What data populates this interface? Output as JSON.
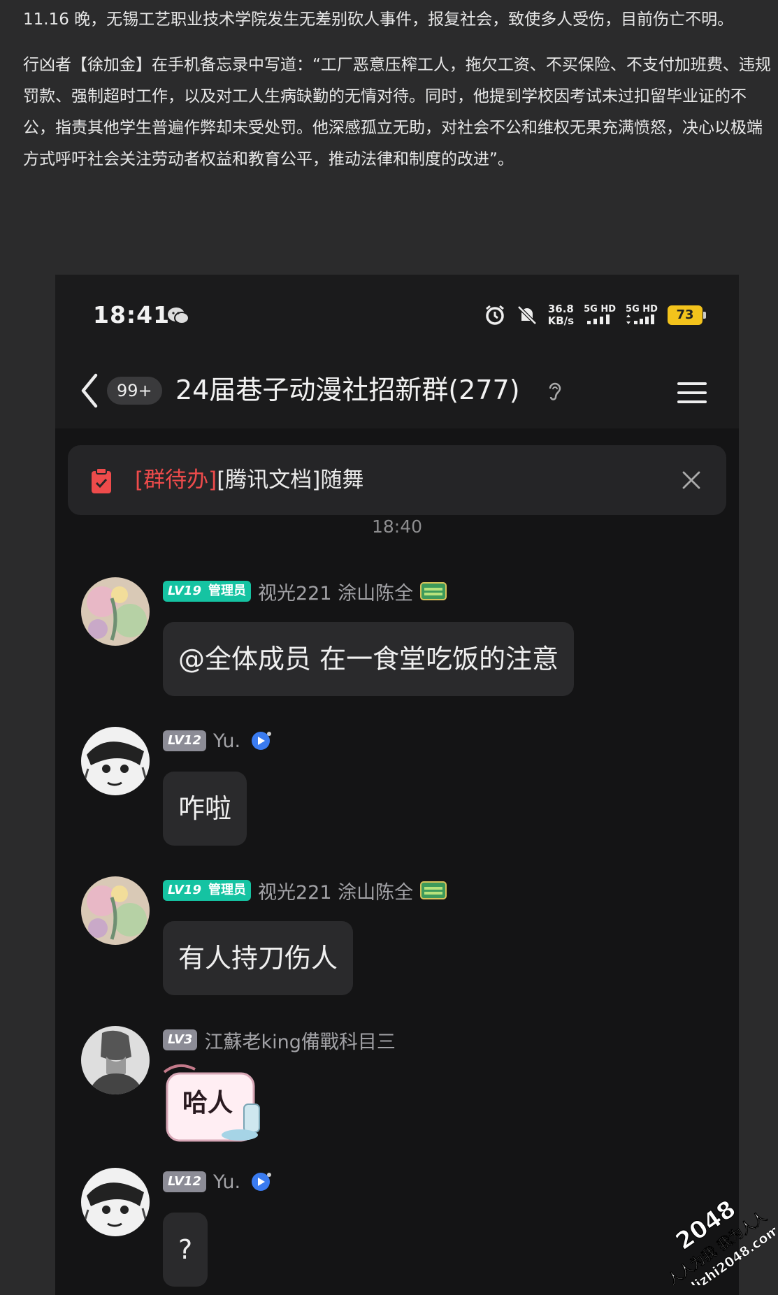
{
  "article": {
    "paragraph1": "11.16 晚，无锡工艺职业技术学院发生无差别砍人事件，报复社会，致使多人受伤，目前伤亡不明。",
    "paragraph2": "行凶者【徐加金】在手机备忘录中写道：“工厂恶意压榨工人，拖欠工资、不买保险、不支付加班费、违规罚款、强制超时工作，以及对工人生病缺勤的无情对待。同时，他提到学校因考试未过扣留毕业证的不公，指责其他学生普遍作弊却未受处罚。他深感孤立无助，对社会不公和维权无果充满愤怒，决心以极端方式呼吁社会关注劳动者权益和教育公平，推动法律和制度的改进”。"
  },
  "status_bar": {
    "time": "18:41",
    "net_speed_value": "36.8",
    "net_speed_unit": "KB/s",
    "signal1": "5G HD",
    "signal2": "5G HD",
    "battery": "73"
  },
  "chat_header": {
    "unread_count": "99+",
    "group_title": "24届巷子动漫社招新群(277)"
  },
  "todo_bar": {
    "tag": "[群待办]",
    "text": "[腾讯文档]随舞"
  },
  "timestamp": "18:40",
  "messages": [
    {
      "level": "LV19",
      "role": "管理员",
      "sender": "视光221 涂山陈全",
      "text": "@全体成员 在一食堂吃饭的注意"
    },
    {
      "level": "LV12",
      "sender": "Yu.",
      "text": "咋啦"
    },
    {
      "level": "LV19",
      "role": "管理员",
      "sender": "视光221 涂山陈全",
      "text": "有人持刀伤人"
    },
    {
      "level": "LV3",
      "sender": "江蘇老king備戰科目三",
      "sticker_text": "哈人"
    },
    {
      "level": "LV12",
      "sender": "Yu.",
      "text": "?"
    }
  ],
  "watermark": {
    "line1": "2048",
    "line2": "人人为我 我为人人",
    "line3": "dizhi2048.com"
  },
  "colors": {
    "page_bg": "#2b2b2c",
    "phone_bg": "#141415",
    "admin_badge": "#15c3a2",
    "level_badge": "#8c8c96",
    "todo_tag": "#ee4b4b",
    "battery": "#f3c31c"
  },
  "icons": [
    "wechat-icon",
    "alarm-icon",
    "mute-icon",
    "back-icon",
    "ear-icon",
    "menu-icon",
    "clipboard-icon",
    "close-icon",
    "badge-icon",
    "play-icon"
  ]
}
